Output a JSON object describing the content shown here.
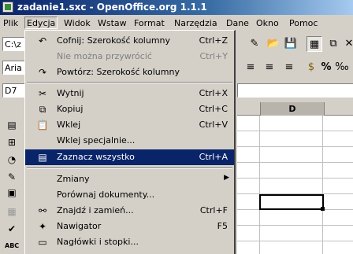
{
  "window": {
    "title": "zadanie1.sxc - OpenOffice.org 1.1.1"
  },
  "menubar": {
    "items": [
      "Plik",
      "Edycja",
      "Widok",
      "Wstaw",
      "Format",
      "Narzędzia",
      "Dane",
      "Okno",
      "Pomoc"
    ],
    "active": "Edycja"
  },
  "toolbar": {
    "url_value": "C:\\z",
    "font_name": "Aria",
    "cell_ref": "D7"
  },
  "sheet": {
    "column_label": "D"
  },
  "edit_menu": {
    "items": [
      {
        "label": "Cofnij: Szerokość kolumny",
        "shortcut": "Ctrl+Z",
        "icon": "undo-icon",
        "enabled": true
      },
      {
        "label": "Nie można przywrócić",
        "shortcut": "Ctrl+Y",
        "icon": "",
        "enabled": false
      },
      {
        "label": "Powtórz: Szerokość kolumny",
        "shortcut": "",
        "icon": "repeat-icon",
        "enabled": true
      },
      {
        "label": "Wytnij",
        "shortcut": "Ctrl+X",
        "icon": "cut-icon",
        "enabled": true
      },
      {
        "label": "Kopiuj",
        "shortcut": "Ctrl+C",
        "icon": "copy-icon",
        "enabled": true
      },
      {
        "label": "Wklej",
        "shortcut": "Ctrl+V",
        "icon": "paste-icon",
        "enabled": true
      },
      {
        "label": "Wklej specjalnie...",
        "shortcut": "",
        "icon": "",
        "enabled": true
      },
      {
        "label": "Zaznacz wszystko",
        "shortcut": "Ctrl+A",
        "icon": "select-all-icon",
        "enabled": true,
        "highlighted": true
      },
      {
        "label": "Zmiany",
        "shortcut": "",
        "icon": "",
        "enabled": true,
        "submenu": true
      },
      {
        "label": "Porównaj dokumenty...",
        "shortcut": "",
        "icon": "",
        "enabled": true
      },
      {
        "label": "Znajdź i zamień...",
        "shortcut": "Ctrl+F",
        "icon": "binoculars-icon",
        "enabled": true
      },
      {
        "label": "Nawigator",
        "shortcut": "F5",
        "icon": "navigator-icon",
        "enabled": true
      },
      {
        "label": "Nagłówki i stopki...",
        "shortcut": "",
        "icon": "header-footer-icon",
        "enabled": true
      }
    ]
  }
}
